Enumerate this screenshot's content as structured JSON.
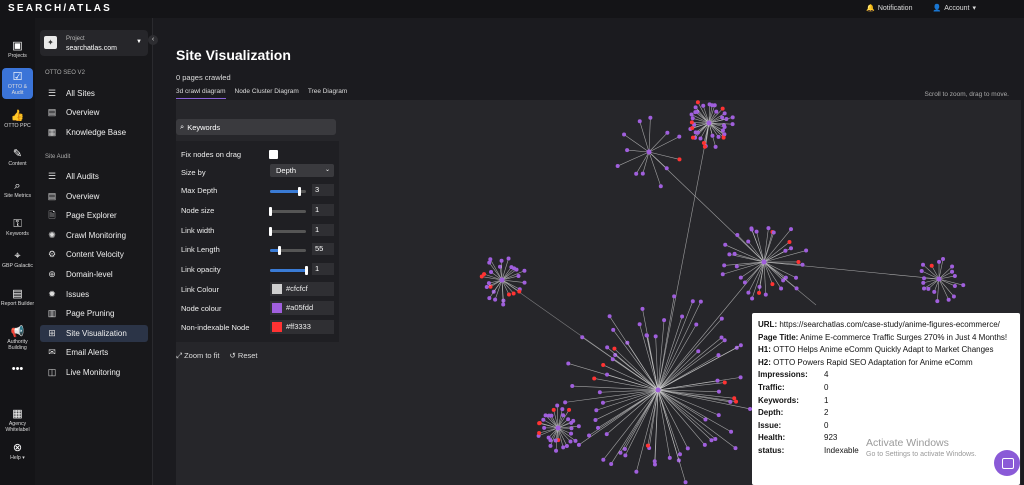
{
  "app": {
    "logo": "SEARCH/ATLAS",
    "notification": "Notification",
    "account": "Account"
  },
  "rail": [
    {
      "label": "Projects",
      "icon": "📋"
    },
    {
      "label": "OTTO & Audit",
      "icon": "✅",
      "active": true
    },
    {
      "label": "OTTO PPC",
      "icon": "👍"
    },
    {
      "label": "Content",
      "icon": "✏"
    },
    {
      "label": "Site Metrics",
      "icon": "🔍"
    },
    {
      "label": "Keywords",
      "icon": "🔑"
    },
    {
      "label": "GBP Galactic",
      "icon": "📍"
    },
    {
      "label": "Report Builder",
      "icon": "📊"
    },
    {
      "label": "Authority Building",
      "icon": "📣"
    },
    {
      "label": "...",
      "icon": "•••"
    },
    {
      "label": "Agency Whitelabel",
      "icon": "🏢"
    },
    {
      "label": "Help ▾",
      "icon": "⊗"
    }
  ],
  "project": {
    "label": "Project",
    "name": "searchatlas.com"
  },
  "sections": {
    "otto": "OTTO SEO V2",
    "audit": "Site Audit"
  },
  "otto_items": [
    {
      "label": "All Sites",
      "icon": "☰"
    },
    {
      "label": "Overview",
      "icon": "▤"
    },
    {
      "label": "Knowledge Base",
      "icon": "▦"
    }
  ],
  "audit_items": [
    {
      "label": "All Audits",
      "icon": "☰"
    },
    {
      "label": "Overview",
      "icon": "▤"
    },
    {
      "label": "Page Explorer",
      "icon": "🗎"
    },
    {
      "label": "Crawl Monitoring",
      "icon": "✺"
    },
    {
      "label": "Content Velocity",
      "icon": "⚙"
    },
    {
      "label": "Domain-level",
      "icon": "⊕"
    },
    {
      "label": "Issues",
      "icon": "⚠"
    },
    {
      "label": "Page Pruning",
      "icon": "▥"
    },
    {
      "label": "Site Visualization",
      "icon": "⊞",
      "active": true
    },
    {
      "label": "Email Alerts",
      "icon": "✉"
    },
    {
      "label": "Live Monitoring",
      "icon": "◫"
    }
  ],
  "page": {
    "title": "Site Visualization",
    "subtitle": "0 pages crawled",
    "tabs": [
      "3d crawl diagram",
      "Node Cluster Diagram",
      "Tree Diagram"
    ],
    "hint": "Scroll to zoom, drag to move."
  },
  "controls": {
    "search": "Keywords",
    "fix_nodes": "Fix nodes on drag",
    "size_by": "Size by",
    "size_by_value": "Depth",
    "max_depth": {
      "label": "Max Depth",
      "value": "3",
      "level": 0.82
    },
    "node_size": {
      "label": "Node size",
      "value": "1",
      "level": 0.0
    },
    "link_width": {
      "label": "Link width",
      "value": "1",
      "level": 0.0
    },
    "link_length": {
      "label": "Link Length",
      "value": "55",
      "level": 0.25
    },
    "link_opacity": {
      "label": "Link opacity",
      "value": "1",
      "level": 1.0
    },
    "link_colour": {
      "label": "Link Colour",
      "value": "#cfcfcf"
    },
    "node_colour": {
      "label": "Node colour",
      "value": "#a05fdd"
    },
    "non_indexable": {
      "label": "Non-indexable Node",
      "value": "#ff3333"
    },
    "zoom_to_fit": "Zoom to fit",
    "reset": "Reset"
  },
  "tooltip": {
    "url_label": "URL:",
    "url": "https://searchatlas.com/case-study/anime-figures-ecommerce/",
    "title_label": "Page Title:",
    "title": "Anime E-commerce Traffic Surges 270% in Just 4 Months!",
    "h1_label": "H1:",
    "h1": "OTTO Helps Anime eComm Quickly Adapt to Market Changes",
    "h2_label": "H2:",
    "h2": "OTTO Powers Rapid SEO Adaptation for Anime eComm",
    "rows": [
      {
        "k": "Impressions:",
        "v": "4"
      },
      {
        "k": "Traffic:",
        "v": "0"
      },
      {
        "k": "Keywords:",
        "v": "1"
      },
      {
        "k": "Depth:",
        "v": "2"
      },
      {
        "k": "Issue:",
        "v": "0"
      },
      {
        "k": "Health:",
        "v": "923"
      },
      {
        "k": "status:",
        "v": "Indexable"
      }
    ]
  },
  "watermark": {
    "line1": "Activate Windows",
    "line2": "Go to Settings to activate Windows."
  }
}
